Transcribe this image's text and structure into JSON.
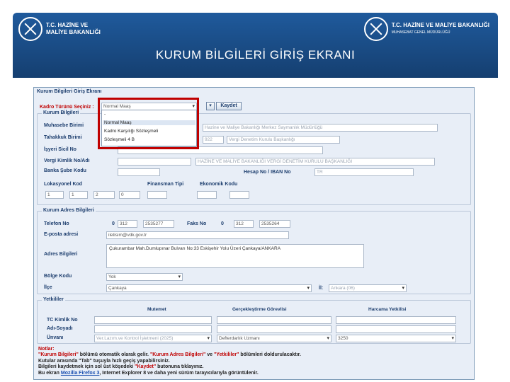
{
  "header": {
    "left_logo_line1": "T.C. HAZİNE VE",
    "left_logo_line2": "MALİYE BAKANLIĞI",
    "right_logo_line1": "T.C. HAZİNE VE MALİYE BAKANLIĞI",
    "right_logo_line2": "MUHASEBAT GENEL MÜDÜRLÜĞÜ",
    "page_title": "KURUM BİLGİLERİ GİRİŞ EKRANI"
  },
  "form": {
    "frame_title": "Kurum Bilgileri Giriş Ekranı",
    "kadro_label": "Kadro Türünü Seçiniz :",
    "kadro_value": "Normal Maaş",
    "save_button": "Kaydet",
    "dropdown_options": [
      "-",
      "Normal Maaş",
      "Kadro Karşılığı Sözleşmeli",
      "Sözleşmeli 4 B"
    ],
    "kurum_bilgileri_title": "Kurum Bilgileri",
    "labels": {
      "muhasebe": "Muhasebe Birimi",
      "tahakkuk": "Tahakkuk Birimi",
      "isyeri": "İşyeri Sicil No",
      "vergi": "Vergi Kimlik No/Adı",
      "banka": "Banka Şube Kodu",
      "hesap": "Hesap No / IBAN No",
      "lokasyonel": "Lokasyonel Kod",
      "finansman": "Finansman Tipi",
      "ekonomik": "Ekonomik Kodu"
    },
    "values": {
      "muhasebe_name": "Hazine ve Maliye Bakanlığı Merkez Saymanlık Müdürlüğü",
      "tahakkuk_code": "922",
      "tahakkuk_name": "Vergi Denetim Kurulu Başkanlığı",
      "vergi_name": "HAZİNE VE MALİYE BAKANLIĞI VERGİ DENETİM KURULU BAŞKANLIĞI",
      "iban_prefix": "TR",
      "lok1": "1",
      "lok2": "1",
      "lok3": "2",
      "lok4": "0"
    },
    "adres_title": "Kurum Adres Bilgileri",
    "adres_labels": {
      "telefon": "Telefon No",
      "faks": "Faks No",
      "eposta": "E-posta adresi",
      "adres": "Adres Bilgileri",
      "bolge": "Bölge Kodu",
      "ilce": "İlçe",
      "il": "İl:"
    },
    "adres_values": {
      "tel_code": "312",
      "tel_no": "2535277",
      "faks_prefix": "0",
      "faks_code": "312",
      "faks_no": "2535264",
      "eposta": "iletisim@vdk.gov.tr",
      "adres": "Çukurambar Mah.Dumlupınar Bulvarı No:33 Eskişehir Yolu Üzeri Çankaya/ANKARA",
      "bolge": "Yok",
      "ilce": "Çankaya",
      "il": "Ankara (06)"
    },
    "yetkililer_title": "Yetkililer",
    "yetkililer_columns": [
      "Mutemet",
      "Gerçekleştirme Görevlisi",
      "Harcama Yetkilisi"
    ],
    "yetkililer_labels": [
      "TC Kimlik No",
      "Adı-Soyadı",
      "Ünvanı"
    ],
    "yetkililer_values": {
      "mutemet_unvan": "Ver.Lazım.ve Kontrol İşletmeni (2025)",
      "gercek_unvan": "Defterdarlık Uzmanı",
      "harcama_unvan": "3250"
    },
    "notes": {
      "title": "Notlar:",
      "line1_a": "\"Kurum Bilgileri\"",
      "line1_b": " bölümü otomatik olarak gelir. ",
      "line1_c": "\"Kurum Adres Bilgileri\"",
      "line1_d": " ve ",
      "line1_e": "\"Yetkililer\"",
      "line1_f": " bölümleri doldurulacaktır.",
      "line2": "Kutular arasında \"Tab\" tuşuyla hızlı geçiş yapabilirsiniz.",
      "line3_a": "Bilgileri kaydetmek için sol üst köşedeki ",
      "line3_b": "\"Kaydet\"",
      "line3_c": " butonuna tıklayınız.",
      "line4_a": "Bu ekran ",
      "line4_b": "Mozilla Firefox 3",
      "line4_c": ", Internet Explorer 8 ve daha yeni sürüm tarayıcılarıyla görüntülenir."
    }
  }
}
